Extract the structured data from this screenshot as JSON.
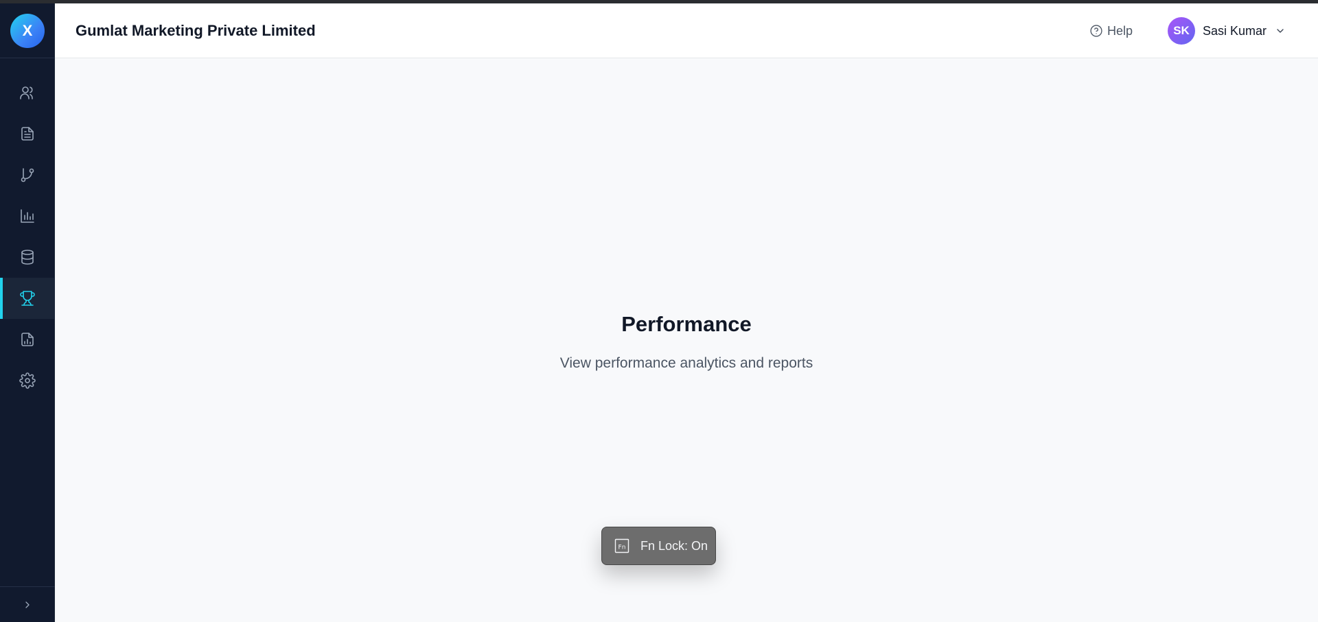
{
  "app": {
    "logo_letter": "X",
    "company_name": "Gumlat Marketing Private Limited"
  },
  "sidebar": {
    "items": [
      {
        "icon": "users-icon",
        "active": false
      },
      {
        "icon": "document-icon",
        "active": false
      },
      {
        "icon": "git-branch-icon",
        "active": false
      },
      {
        "icon": "bar-chart-icon",
        "active": false
      },
      {
        "icon": "database-icon",
        "active": false
      },
      {
        "icon": "trophy-icon",
        "active": true
      },
      {
        "icon": "report-icon",
        "active": false
      },
      {
        "icon": "gear-icon",
        "active": false
      }
    ],
    "footer_icon": "chevron-right-icon"
  },
  "header": {
    "help_label": "Help",
    "user_initials": "SK",
    "user_name": "Sasi Kumar"
  },
  "main": {
    "title": "Performance",
    "subtitle": "View performance analytics and reports"
  },
  "toast": {
    "icon_text": "Fn",
    "text": "Fn Lock: On"
  },
  "colors": {
    "sidebar_bg": "#111a2e",
    "accent": "#22d3ee",
    "avatar_start": "#a855f7",
    "avatar_end": "#6366f1"
  }
}
